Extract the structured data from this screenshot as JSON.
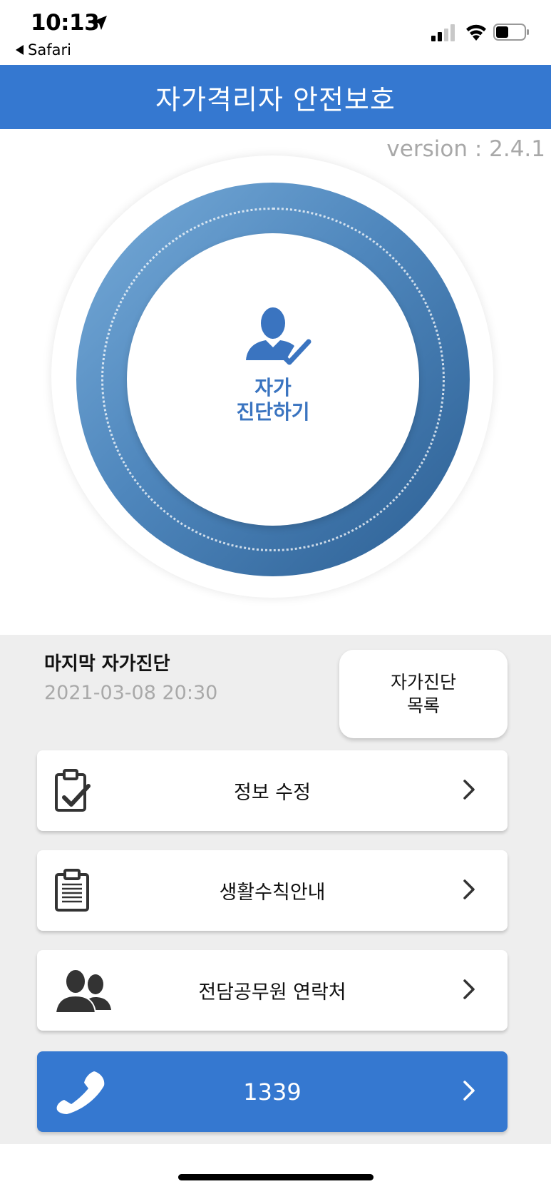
{
  "status_bar": {
    "time": "10:13",
    "back_app": "Safari",
    "icons": [
      "location-arrow-icon",
      "cellular-signal-icon",
      "wifi-icon",
      "battery-icon"
    ]
  },
  "header": {
    "title": "자가격리자 안전보호"
  },
  "version": "version : 2.4.1",
  "self_diagnosis": {
    "label_line1": "자가",
    "label_line2": "진단하기",
    "icon": "person-check-icon"
  },
  "last_diagnosis": {
    "title": "마지막 자가진단",
    "datetime": "2021-03-08 20:30"
  },
  "diagnosis_list_button": {
    "line1": "자가진단",
    "line2": "목록"
  },
  "menu": [
    {
      "label": "정보 수정",
      "icon": "clipboard-check-icon"
    },
    {
      "label": "생활수칙안내",
      "icon": "clipboard-list-icon"
    },
    {
      "label": "전담공무원 연락처",
      "icon": "users-icon"
    },
    {
      "label": "1339",
      "icon": "phone-icon"
    }
  ],
  "colors": {
    "primary": "#3578d0",
    "ring_light": "#78acd9",
    "ring_dark": "#2c5f93",
    "background_gray": "#eeeeee",
    "muted_text": "#a9a9a9"
  }
}
